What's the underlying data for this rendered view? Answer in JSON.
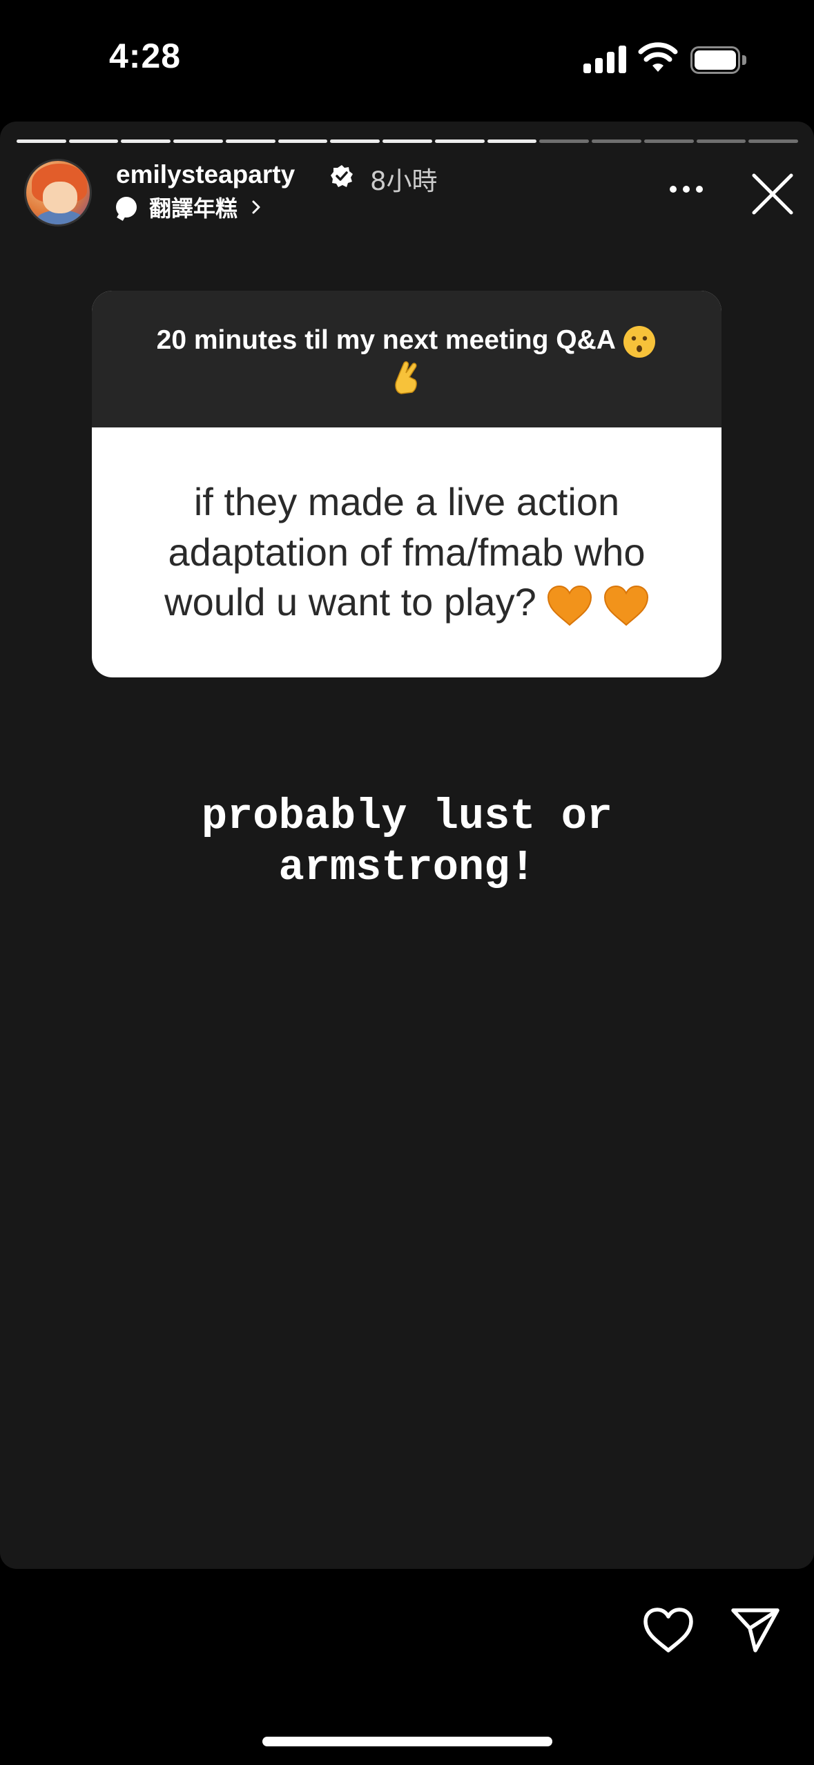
{
  "status_bar": {
    "time": "4:28"
  },
  "story": {
    "progress": {
      "total_segments": 15,
      "completed_segments": 10
    },
    "user": {
      "username": "emilysteaparty",
      "verified": true,
      "time_ago": "8小時"
    },
    "subtitle": {
      "label": "翻譯年糕"
    },
    "question_card": {
      "header": "20 minutes til my next meeting Q&A",
      "header_emojis": [
        "kissing-face",
        "crossed-fingers"
      ],
      "question": "if they made a live action adaptation of fma/fmab who would u want to play?",
      "question_emojis": [
        "orange-heart",
        "orange-heart"
      ]
    },
    "answer": "probably lust or\narmstrong!"
  },
  "colors": {
    "background": "#000000",
    "story_bg": "#181818",
    "card_header_bg": "#262626",
    "heart": "#f2931b"
  }
}
